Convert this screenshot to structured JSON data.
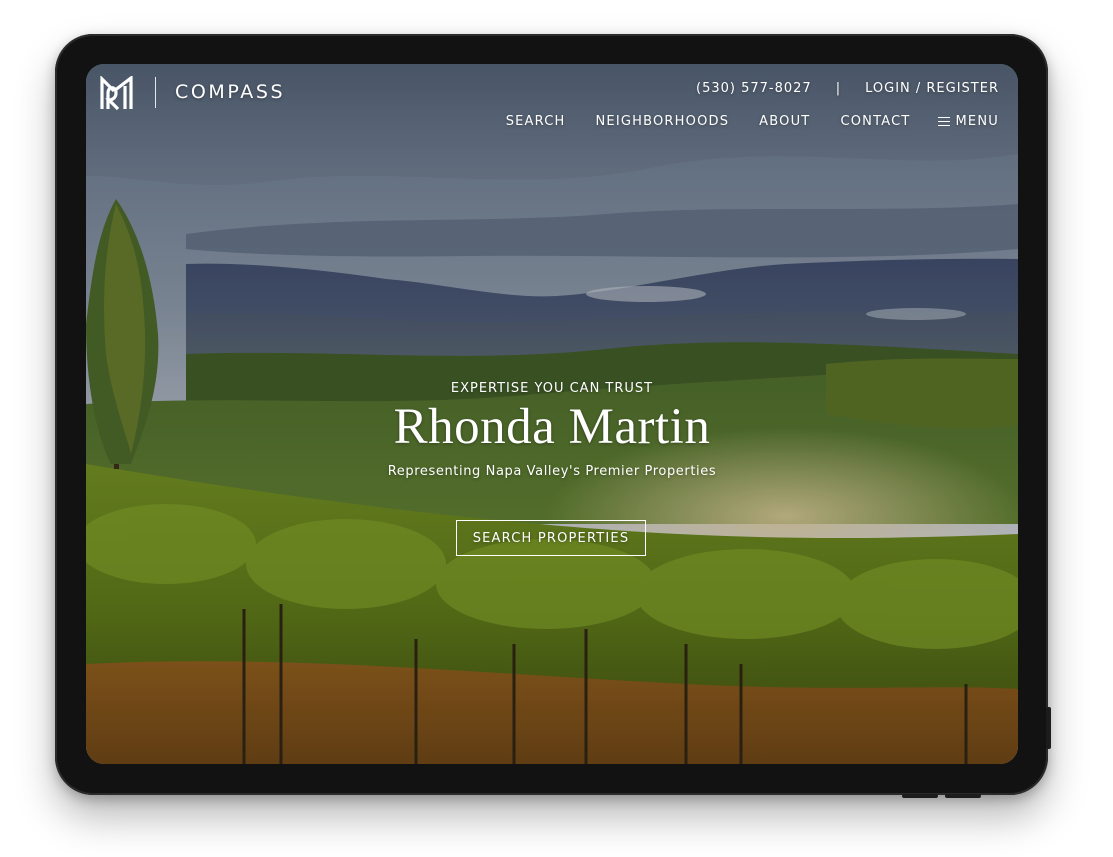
{
  "brand": {
    "agent_monogram": "RM",
    "company": "COMPASS"
  },
  "header": {
    "phone": "(530) 577-8027",
    "separator": "|",
    "login_label": "LOGIN / REGISTER",
    "nav": [
      {
        "label": "SEARCH"
      },
      {
        "label": "NEIGHBORHOODS"
      },
      {
        "label": "ABOUT"
      },
      {
        "label": "CONTACT"
      }
    ],
    "menu_label": "MENU",
    "menu_icon": "hamburger-icon"
  },
  "hero": {
    "eyebrow": "EXPERTISE YOU CAN TRUST",
    "name": "Rhonda Martin",
    "tagline": "Representing Napa Valley's Premier Properties",
    "cta_label": "SEARCH PROPERTIES",
    "background": "Napa Valley vineyard landscape with misty hills"
  },
  "colors": {
    "device_frame": "#121212",
    "text": "#ffffff"
  }
}
